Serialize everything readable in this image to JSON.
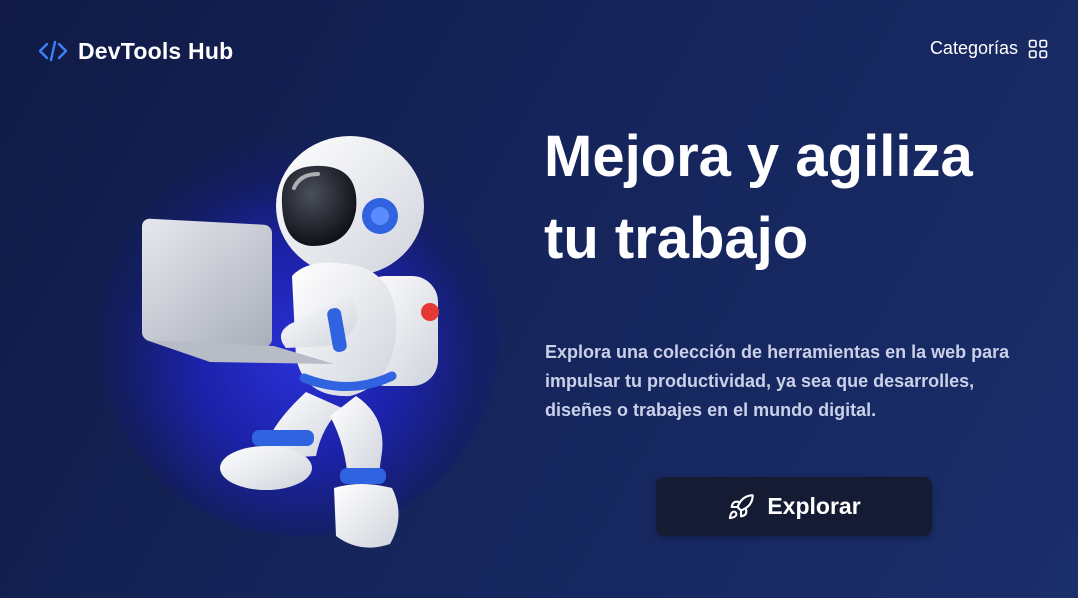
{
  "header": {
    "logo_text": "DevTools Hub",
    "logo_icon": "code-icon",
    "categories_label": "Categorías",
    "categories_icon": "grid-icon"
  },
  "hero": {
    "title_line1": "Mejora y agiliza",
    "title_line2": "tu trabajo",
    "description": "Explora una colección de herramientas en la web para impulsar tu productividad, ya sea que desarrolles, diseñes o trabajes en el mundo digital.",
    "cta_label": "Explorar",
    "cta_icon": "rocket-icon",
    "illustration": "astronaut-with-laptop"
  },
  "colors": {
    "background": "#15245a",
    "accent": "#3b82f6",
    "button_bg": "#141b33",
    "text": "#ffffff",
    "muted_text": "#c9d0e8"
  }
}
